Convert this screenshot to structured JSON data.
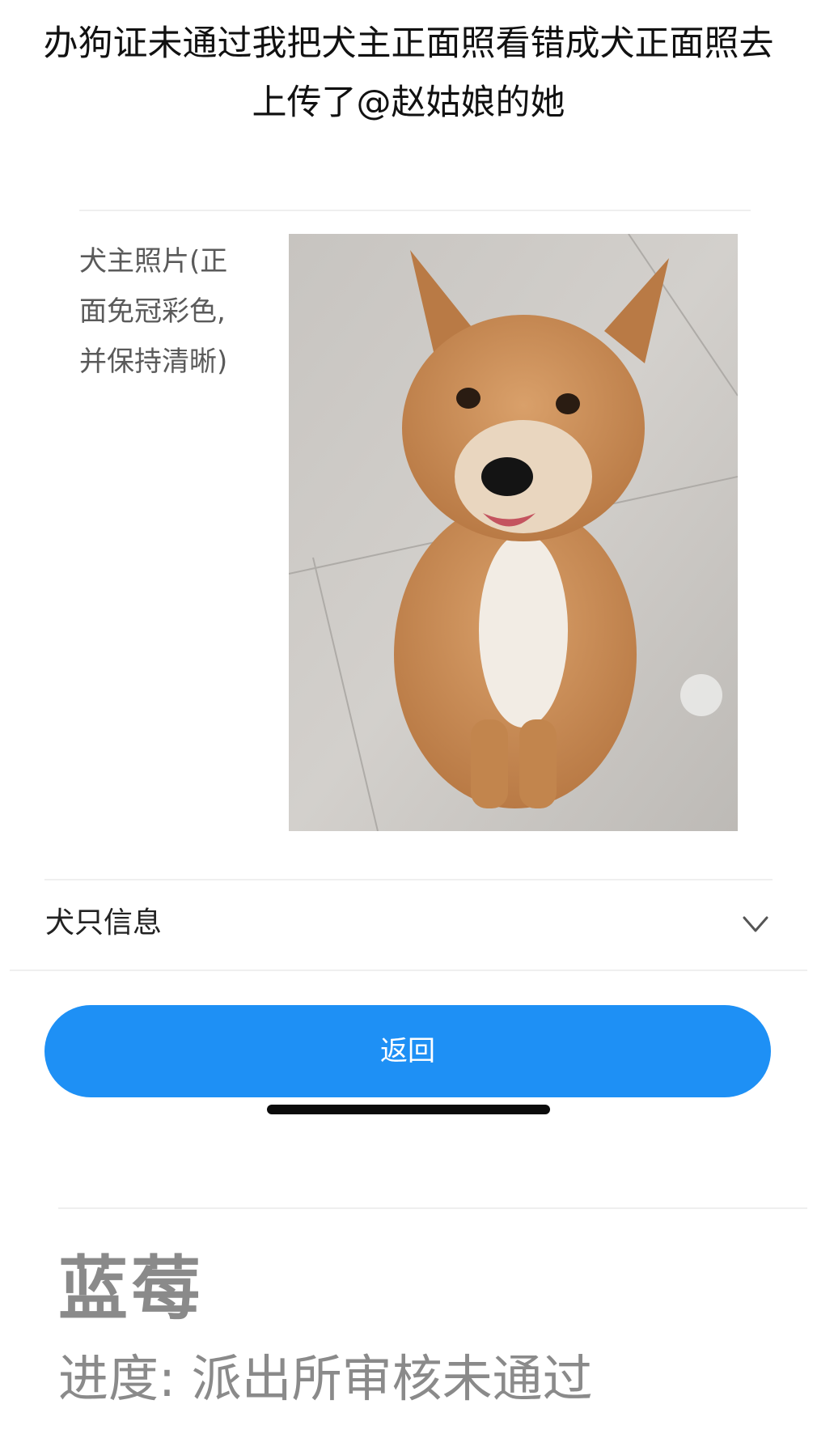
{
  "caption": {
    "line1": "办狗证未通过我把犬主正面照看错成犬正面照去",
    "line2": "上传了@赵姑娘的她"
  },
  "owner_photo": {
    "label_line1": "犬主照片(正",
    "label_line2": "面免冠彩色,",
    "label_line3": "并保持清晰)"
  },
  "dog_info": {
    "label": "犬只信息",
    "icon": "chevron-down-icon"
  },
  "back_button": {
    "label": "返回",
    "color": "#1e90f5"
  },
  "footer": {
    "name": "蓝莓",
    "progress": "进度: 派出所审核未通过"
  }
}
